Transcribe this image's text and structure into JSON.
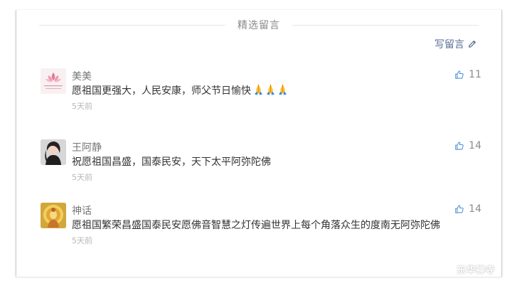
{
  "section_title": "精选留言",
  "write_comment": {
    "label": "写留言",
    "icon": "pencil-icon"
  },
  "comments": [
    {
      "name": "美美",
      "text": "愿祖国更强大，人民安康，师父节日愉快",
      "emoji": "folded-hands",
      "time": "5天前",
      "likes": "11",
      "avatar": "lotus-avatar"
    },
    {
      "name": "王阿静",
      "text": "祝愿祖国昌盛，国泰民安，天下太平阿弥陀佛",
      "time": "5天前",
      "likes": "14",
      "avatar": "person-avatar"
    },
    {
      "name": "神话",
      "text": "愿祖国繁荣昌盛国泰民安愿佛音智慧之灯传遍世界上每个角落众生的度南无阿弥陀佛",
      "time": "5天前",
      "likes": "14",
      "avatar": "buddha-avatar"
    }
  ],
  "watermark": "东华禅寺",
  "colors": {
    "link": "#576b95",
    "name": "#767676",
    "text": "#333333",
    "time": "#b7b7b7",
    "like": "#8c8c8c"
  }
}
